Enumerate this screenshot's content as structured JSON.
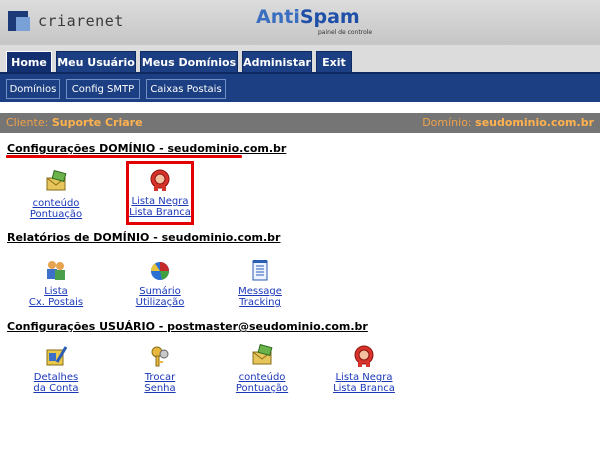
{
  "header": {
    "logo_text": "criarenet",
    "brand_anti": "Anti",
    "brand_spam": "Spam",
    "brand_sub": "painel de controle"
  },
  "tabs": [
    {
      "label": "Home",
      "active": true
    },
    {
      "label": "Meu Usuário"
    },
    {
      "label": "Meus Domínios"
    },
    {
      "label": "Administar"
    },
    {
      "label": "Exit"
    }
  ],
  "subtabs": [
    {
      "label": "Domínios"
    },
    {
      "label": "Config SMTP"
    },
    {
      "label": "Caixas Postais"
    }
  ],
  "clientbar": {
    "client_prefix": "Cliente:",
    "client_name": "Suporte Criare",
    "domain_prefix": "Domínio:",
    "domain_name": "seudominio.com.br"
  },
  "sections": {
    "config_dominio": {
      "title": "Configurações DOMÍNIO - seudominio.com.br",
      "items": [
        {
          "line1": "conteúdo",
          "line2": "Pontuação",
          "icon": "envelope-icon"
        },
        {
          "line1": "Lista Negra",
          "line2": "Lista Branca",
          "icon": "seal-icon"
        }
      ]
    },
    "relatorios": {
      "title": "Relatórios de DOMÍNIO - seudominio.com.br",
      "items": [
        {
          "line1": "Lista",
          "line2": "Cx. Postais",
          "icon": "users-icon"
        },
        {
          "line1": "Sumário",
          "line2": "Utilização",
          "icon": "pie-chart-icon"
        },
        {
          "line1": "Message",
          "line2": "Tracking",
          "icon": "notepad-icon"
        }
      ]
    },
    "config_usuario": {
      "title": "Configurações USUÁRIO - postmaster@seudominio.com.br",
      "items": [
        {
          "line1": "Detalhes",
          "line2": "da Conta",
          "icon": "edit-icon"
        },
        {
          "line1": "Trocar",
          "line2": "Senha",
          "icon": "key-icon"
        },
        {
          "line1": "conteúdo",
          "line2": "Pontuação",
          "icon": "envelope-icon"
        },
        {
          "line1": "Lista Negra",
          "line2": "Lista Branca",
          "icon": "seal-icon"
        }
      ]
    }
  },
  "colors": {
    "nav_blue": "#1b3f82",
    "link_blue": "#1a37b8",
    "client_orange": "#ffb24e",
    "highlight_red": "#e40000"
  }
}
